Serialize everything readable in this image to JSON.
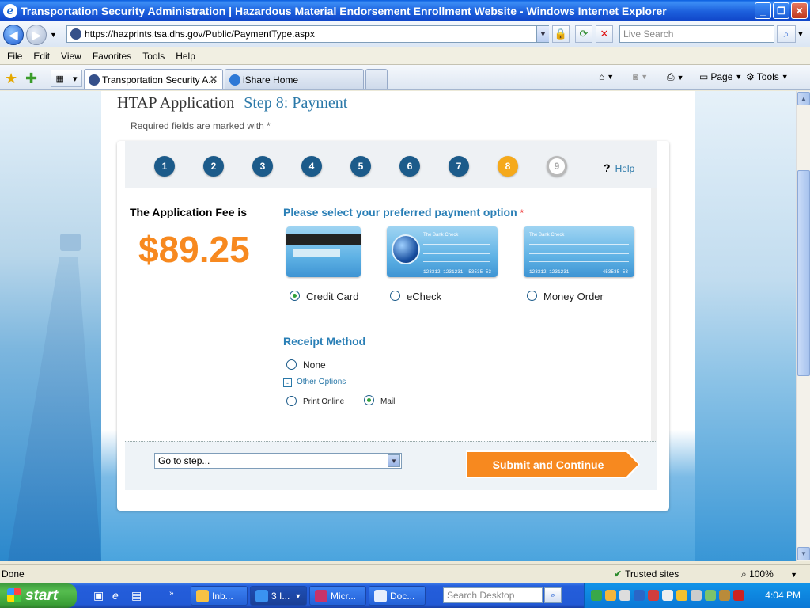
{
  "window": {
    "title": "Transportation Security Administration | Hazardous Material Endorsement Enrollment Website - Windows Internet Explorer",
    "buttons": [
      "_",
      "❐",
      "✕"
    ]
  },
  "address_bar": {
    "url": "https://hazprints.tsa.dhs.gov/Public/PaymentType.aspx",
    "search_placeholder": "Live Search"
  },
  "menu": [
    "File",
    "Edit",
    "View",
    "Favorites",
    "Tools",
    "Help"
  ],
  "tabs": [
    {
      "label": "Transportation Security A...",
      "active": true
    },
    {
      "label": "iShare Home",
      "active": false
    }
  ],
  "command_bar": {
    "page_label": "Page",
    "tools_label": "Tools"
  },
  "page": {
    "app_title": "HTAP Application",
    "step_title": "Step 8: Payment",
    "required_note": "Required fields are marked with *",
    "steps": [
      "1",
      "2",
      "3",
      "4",
      "5",
      "6",
      "7",
      "8",
      "9"
    ],
    "current_step": 8,
    "help_icon": "?",
    "help_label": "Help",
    "fee_label": "The Application Fee is",
    "fee_amount": "$89.25",
    "payment_title": "Please select your preferred payment option",
    "required_marker": "*",
    "payment_options": [
      {
        "label": "Credit Card",
        "selected": true,
        "card_numbers": "",
        "card_numbers2": ""
      },
      {
        "label": "eCheck",
        "selected": false,
        "bank": "The Bank Check",
        "card_numbers": "123312 1231231",
        "card_numbers2": "53535 53"
      },
      {
        "label": "Money Order",
        "selected": false,
        "bank": "The Bank Check",
        "card_numbers": "123312 1231231",
        "card_numbers2": "453535 53"
      }
    ],
    "receipt_title": "Receipt Method",
    "receipt_none": "None",
    "other_options": "Other Options",
    "expander_symbol": "-",
    "receipt_print": "Print Online",
    "receipt_mail": "Mail",
    "receipt_selected": "Mail",
    "goto_placeholder": "Go to step...",
    "submit_label": "Submit and Continue"
  },
  "status_bar": {
    "status": "Done",
    "zone": "Trusted sites",
    "zoom": "100%"
  },
  "taskbar": {
    "start": "start",
    "tasks": [
      {
        "label": "Inb...",
        "active": false
      },
      {
        "label": "3 I...",
        "active": true
      },
      {
        "label": "Micr...",
        "active": false
      },
      {
        "label": "Doc...",
        "active": false
      }
    ],
    "search_placeholder": "Search Desktop",
    "clock": "4:04 PM"
  },
  "colors": {
    "accent_orange": "#f7891f",
    "step_blue": "#1c5b8a",
    "current_step": "#f5a91b",
    "heading_blue": "#2a7fb6"
  }
}
